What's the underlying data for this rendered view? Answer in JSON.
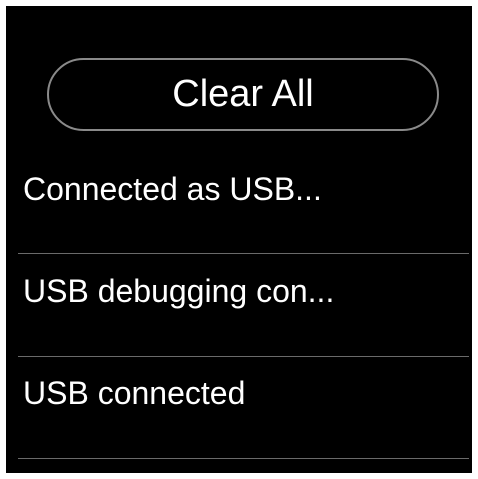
{
  "actions": {
    "clear_all_label": "Clear All"
  },
  "notifications": [
    {
      "title": "Connected as USB..."
    },
    {
      "title": "USB debugging con..."
    },
    {
      "title": "USB connected"
    }
  ],
  "colors": {
    "background": "#000000",
    "text": "#ffffff",
    "divider": "#6a6a6a",
    "button_border": "#8a8a8a"
  }
}
